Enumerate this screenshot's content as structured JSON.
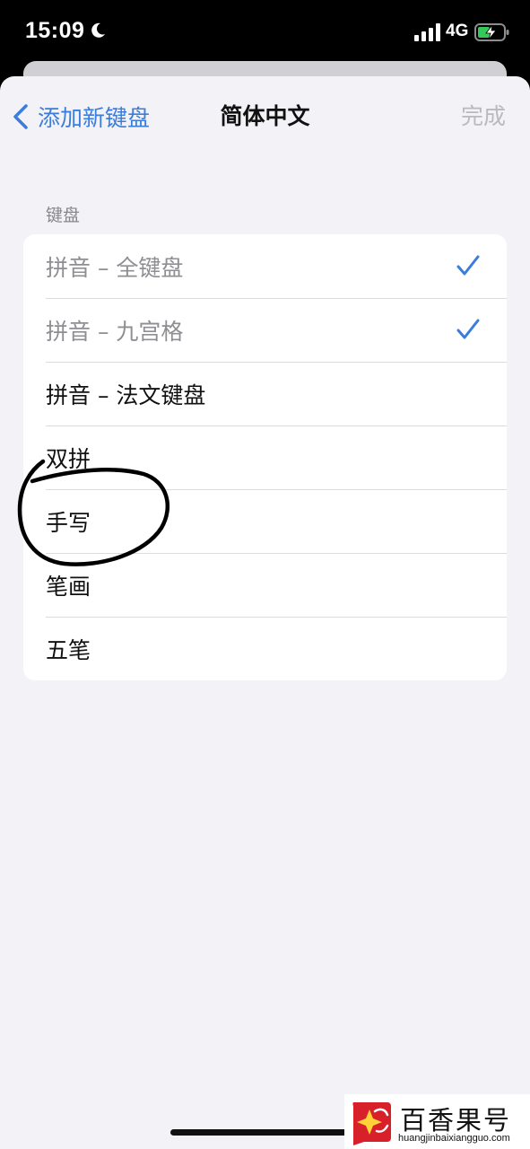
{
  "status_bar": {
    "time": "15:09",
    "network": "4G"
  },
  "nav": {
    "back_label": "添加新键盘",
    "title": "简体中文",
    "done_label": "完成"
  },
  "section": {
    "header": "键盘"
  },
  "keyboards": [
    {
      "label": "拼音 – 全键盘",
      "checked": true
    },
    {
      "label": "拼音 – 九宫格",
      "checked": true
    },
    {
      "label": "拼音 – 法文键盘",
      "checked": false
    },
    {
      "label": "双拼",
      "checked": false
    },
    {
      "label": "手写",
      "checked": false
    },
    {
      "label": "笔画",
      "checked": false
    },
    {
      "label": "五笔",
      "checked": false
    }
  ],
  "watermark": {
    "title": "百香果号",
    "url": "huangjinbaixiangguo.com"
  },
  "colors": {
    "accent": "#3b7ddd",
    "disabled_text": "#8e8e93",
    "sheet_background": "#f2f2f7",
    "watermark_red": "#d8202a"
  }
}
